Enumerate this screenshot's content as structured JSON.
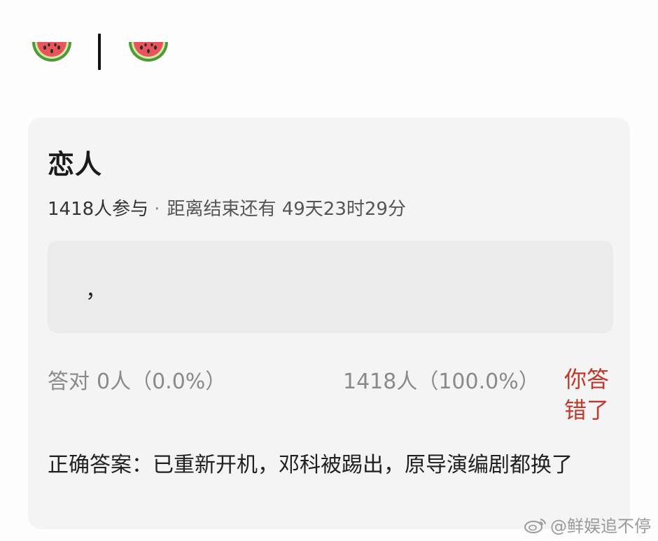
{
  "header": {
    "left_icon": "watermelon-icon",
    "right_icon": "watermelon-icon"
  },
  "poll": {
    "title": "恋人",
    "participants": "1418人参与",
    "separator": "·",
    "countdown_label": "距离结束还有",
    "countdown_value": "49天23时29分",
    "option_text": "，",
    "correct_label": "答对",
    "correct_count": "0人（0.0%）",
    "wrong_count": "1418人（100.0%）",
    "result_flag": "你答错了",
    "answer_text": "正确答案：已重新开机，邓科被踢出，原导演编剧都换了"
  },
  "watermark": {
    "icon": "weibo-icon",
    "text": "@鲜娱追不停"
  },
  "colors": {
    "background": "#fdfdfd",
    "card": "#f4f4f4",
    "option_box": "#ebebeb",
    "wrong_flag": "#c0392b",
    "muted_text": "#8a8a8a",
    "melon_rind": "#5a9e3a",
    "melon_flesh": "#e8545a"
  }
}
